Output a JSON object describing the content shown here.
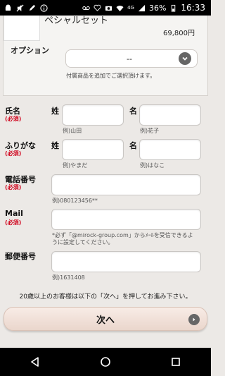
{
  "status_bar": {
    "battery": "36%",
    "time": "16:33",
    "network": "4G",
    "icons": [
      "android-icon",
      "mute-icon",
      "edit-icon",
      "info-icon",
      "voicemail-icon",
      "heart-icon",
      "camera-icon",
      "wifi-icon",
      "signal-icon",
      "battery-icon"
    ]
  },
  "product": {
    "name": "ペシャルセット",
    "price": "69,800円"
  },
  "option": {
    "label": "オプション",
    "selected": "--",
    "note": "付属商品を追加でご選択頂けます。"
  },
  "form": {
    "name": {
      "label": "氏名",
      "required": "(必須)",
      "last_label": "姓",
      "first_label": "名",
      "last_hint": "例)山田",
      "first_hint": "例)花子"
    },
    "kana": {
      "label": "ふりがな",
      "required": "(必須)",
      "last_label": "姓",
      "first_label": "名",
      "last_hint": "例)やまだ",
      "first_hint": "例)はなこ"
    },
    "phone": {
      "label": "電話番号",
      "required": "(必須)",
      "hint": "例)080123456**"
    },
    "mail": {
      "label": "Mail",
      "required": "(必須)",
      "hint_line1": "*必ず「@mirock-group.com」からﾒｰﾙを受信できるよ",
      "hint_line2": "うに設定してください。"
    },
    "postal": {
      "label": "郵便番号",
      "hint": "例)1631408"
    }
  },
  "notice": "20歳以上のお客様は以下の「次へ」を押してお進み下さい。",
  "next_button": "次へ",
  "nav": {
    "icons": [
      "back-icon",
      "home-icon",
      "recents-icon"
    ]
  }
}
